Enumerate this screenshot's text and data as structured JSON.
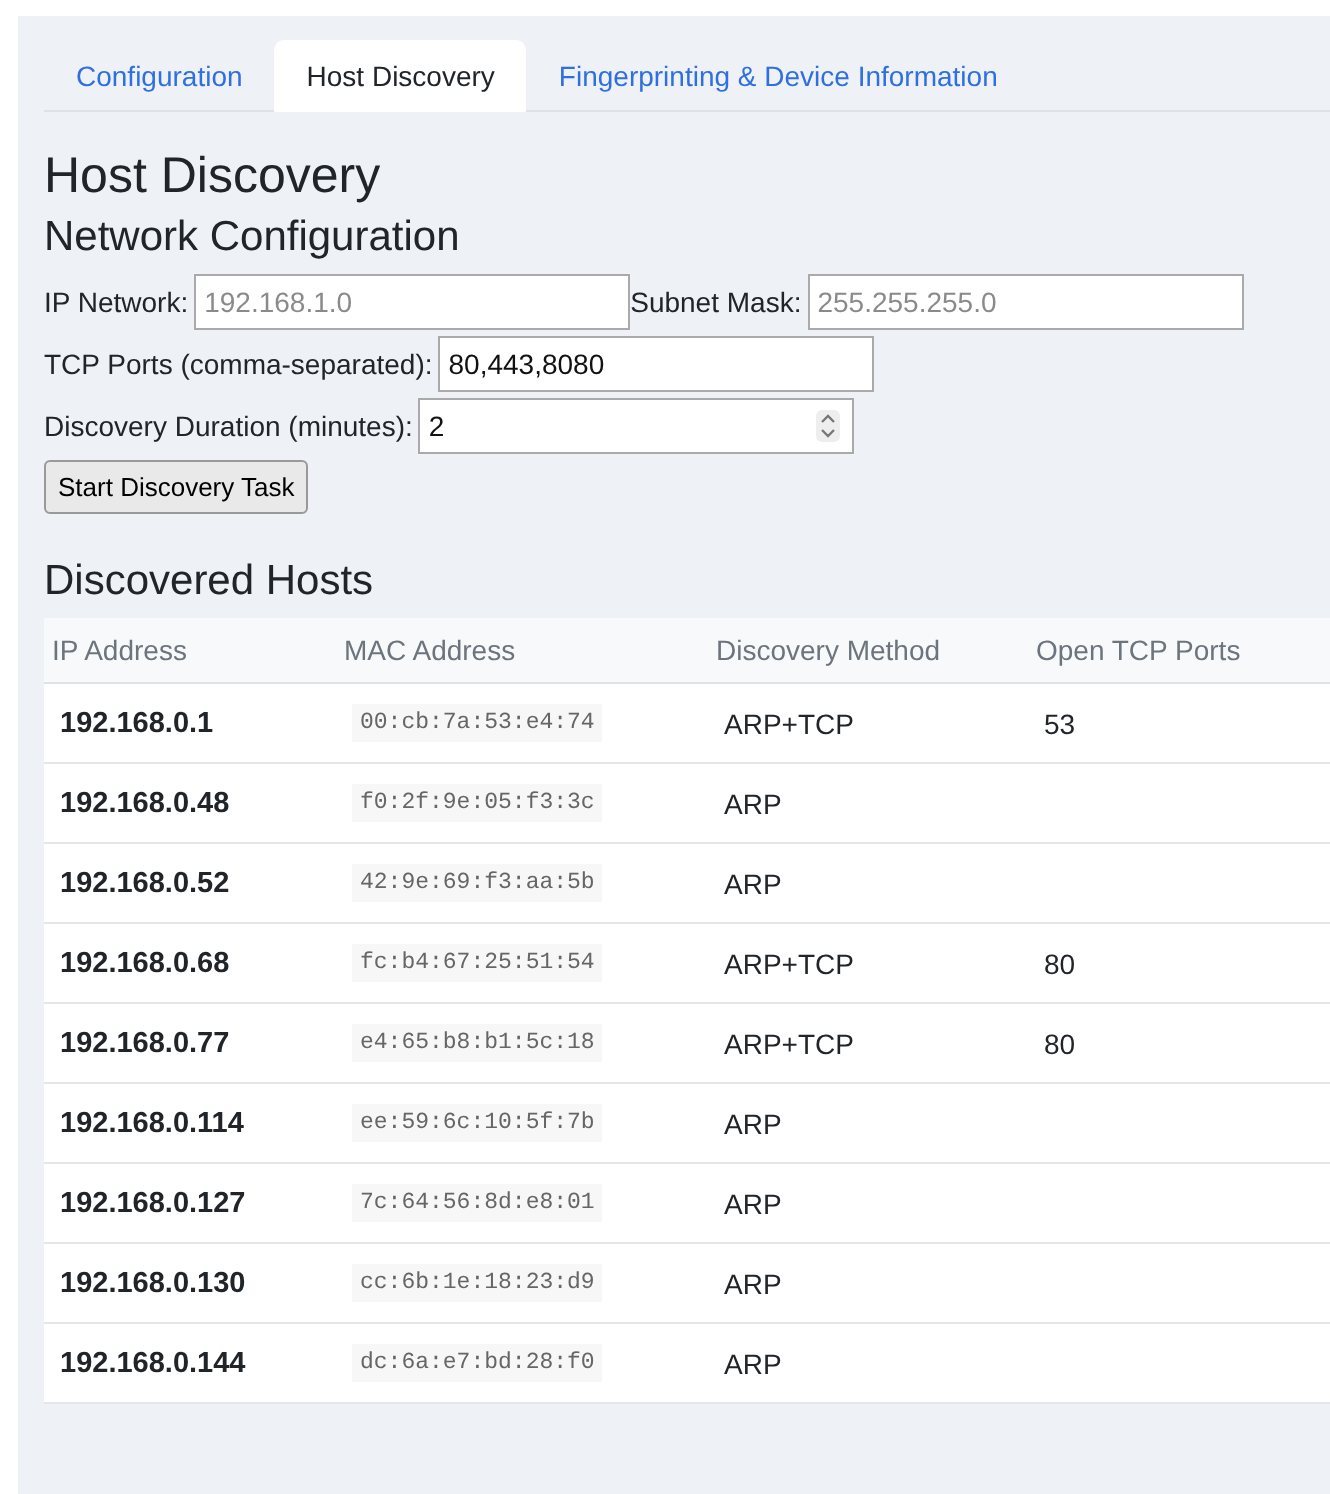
{
  "tabs": [
    {
      "label": "Configuration",
      "selected": false
    },
    {
      "label": "Host Discovery",
      "selected": true
    },
    {
      "label": "Fingerprinting & Device Information",
      "selected": false
    }
  ],
  "title": "Host Discovery",
  "network_configuration": {
    "heading": "Network Configuration",
    "ip_network": {
      "label": "IP Network:",
      "placeholder": "192.168.1.0"
    },
    "subnet_mask": {
      "label": "Subnet Mask:",
      "placeholder": "255.255.255.0"
    },
    "tcp_ports": {
      "label": "TCP Ports (comma-separated):",
      "value": "80,443,8080"
    },
    "duration": {
      "label": "Discovery Duration (minutes):",
      "value": "2"
    },
    "start_button": "Start Discovery Task"
  },
  "discovered_hosts": {
    "heading": "Discovered Hosts",
    "columns": [
      "IP Address",
      "MAC Address",
      "Discovery Method",
      "Open TCP Ports"
    ],
    "rows": [
      {
        "ip": "192.168.0.1",
        "mac": "00:cb:7a:53:e4:74",
        "method": "ARP+TCP",
        "ports": "53"
      },
      {
        "ip": "192.168.0.48",
        "mac": "f0:2f:9e:05:f3:3c",
        "method": "ARP"
      },
      {
        "ip": "192.168.0.52",
        "mac": "42:9e:69:f3:aa:5b",
        "method": "ARP"
      },
      {
        "ip": "192.168.0.68",
        "mac": "fc:b4:67:25:51:54",
        "method": "ARP+TCP",
        "ports": "80"
      },
      {
        "ip": "192.168.0.77",
        "mac": "e4:65:b8:b1:5c:18",
        "method": "ARP+TCP",
        "ports": "80"
      },
      {
        "ip": "192.168.0.114",
        "mac": "ee:59:6c:10:5f:7b",
        "method": "ARP"
      },
      {
        "ip": "192.168.0.127",
        "mac": "7c:64:56:8d:e8:01",
        "method": "ARP"
      },
      {
        "ip": "192.168.0.130",
        "mac": "cc:6b:1e:18:23:d9",
        "method": "ARP"
      },
      {
        "ip": "192.168.0.144",
        "mac": "dc:6a:e7:bd:28:f0",
        "method": "ARP"
      }
    ]
  }
}
